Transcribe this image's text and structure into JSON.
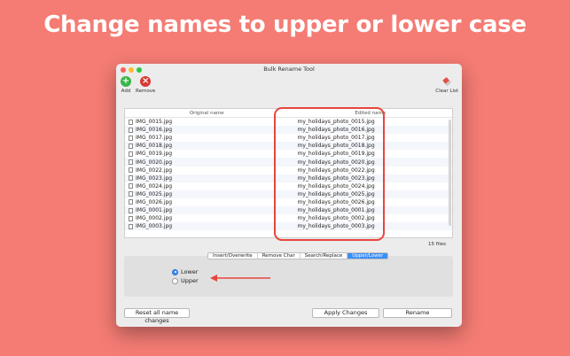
{
  "headline": "Change names to upper or lower case",
  "window": {
    "title": "Bulk Rename Tool"
  },
  "toolbar": {
    "add_label": "Add",
    "remove_label": "Remove",
    "clear_label": "Clear List"
  },
  "table": {
    "col_original": "Original name",
    "col_edited": "Edited name",
    "rows": [
      {
        "original": "IMG_0015.jpg",
        "edited": "my_holidays_photo_0015.jpg"
      },
      {
        "original": "IMG_0016.jpg",
        "edited": "my_holidays_photo_0016.jpg"
      },
      {
        "original": "IMG_0017.jpg",
        "edited": "my_holidays_photo_0017.jpg"
      },
      {
        "original": "IMG_0018.jpg",
        "edited": "my_holidays_photo_0018.jpg"
      },
      {
        "original": "IMG_0019.jpg",
        "edited": "my_holidays_photo_0019.jpg"
      },
      {
        "original": "IMG_0020.jpg",
        "edited": "my_holidays_photo_0020.jpg"
      },
      {
        "original": "IMG_0022.jpg",
        "edited": "my_holidays_photo_0022.jpg"
      },
      {
        "original": "IMG_0023.jpg",
        "edited": "my_holidays_photo_0023.jpg"
      },
      {
        "original": "IMG_0024.jpg",
        "edited": "my_holidays_photo_0024.jpg"
      },
      {
        "original": "IMG_0025.jpg",
        "edited": "my_holidays_photo_0025.jpg"
      },
      {
        "original": "IMG_0026.jpg",
        "edited": "my_holidays_photo_0026.jpg"
      },
      {
        "original": "IMG_0001.jpg",
        "edited": "my_holidays_photo_0001.jpg"
      },
      {
        "original": "IMG_0002.jpg",
        "edited": "my_holidays_photo_0002.jpg"
      },
      {
        "original": "IMG_0003.jpg",
        "edited": "my_holidays_photo_0003.jpg"
      }
    ]
  },
  "file_count": "15 files",
  "tabs": [
    "Insert/Overwrite",
    "Remove Char",
    "Search/Replace",
    "Upper/Lower"
  ],
  "active_tab": "Upper/Lower",
  "case_options": {
    "lower": "Lower",
    "upper": "Upper",
    "selected": "Lower"
  },
  "buttons": {
    "reset": "Reset all name changes",
    "apply": "Apply Changes",
    "rename": "Rename"
  },
  "colors": {
    "background": "#f47c74",
    "accent": "#3d8ef5",
    "callout": "#e8463c"
  },
  "icons": {
    "add": "plus-circle-icon",
    "remove": "x-circle-icon",
    "clear": "eraser-icon",
    "file": "file-icon"
  }
}
